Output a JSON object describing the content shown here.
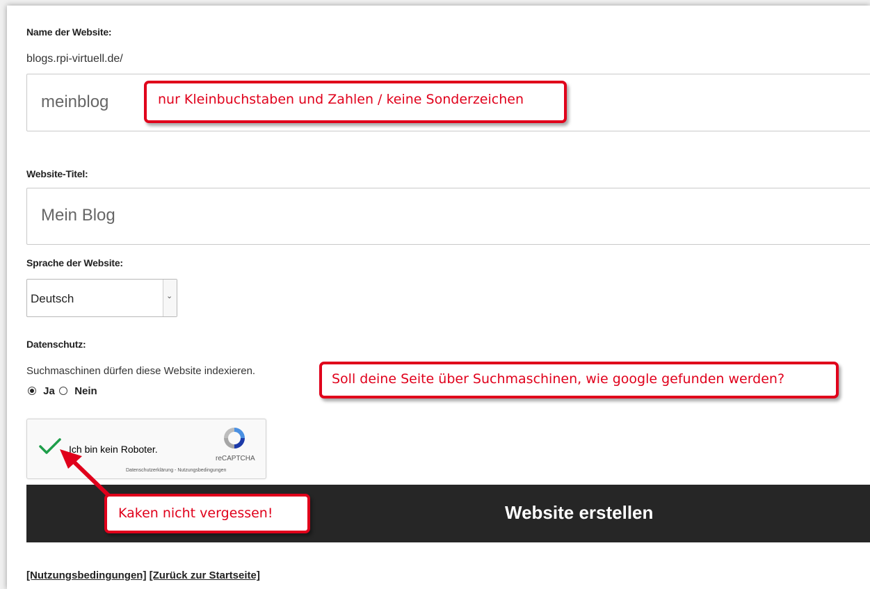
{
  "form": {
    "site_name_label": "Name der Website:",
    "domain_prefix": "blogs.rpi-virtuell.de/",
    "site_name_value": "meinblog",
    "site_title_label": "Website-Titel:",
    "site_title_value": "Mein Blog",
    "language_label": "Sprache der Website:",
    "language_value": "Deutsch",
    "privacy_label": "Datenschutz:",
    "privacy_text": "Suchmaschinen dürfen diese Website indexieren.",
    "privacy_yes": "Ja",
    "privacy_no": "Nein",
    "privacy_selected": "Ja",
    "submit_label": "Website erstellen"
  },
  "captcha": {
    "label": "Ich bin kein Roboter.",
    "brand": "reCAPTCHA",
    "privacy_link": "Datenschutzerklärung",
    "separator": " - ",
    "terms_link": "Nutzungsbedingungen",
    "checked": true
  },
  "footer": {
    "terms_link": "[Nutzungsbedingungen]",
    "home_link": "[Zurück zur Startseite]"
  },
  "annotations": {
    "site_name_note": "nur Kleinbuchstaben und Zahlen / keine Sonderzeichen",
    "privacy_note": "Soll deine Seite über Suchmaschinen, wie google gefunden werden?",
    "captcha_note": "Kaken nicht vergessen!"
  },
  "colors": {
    "annotation_red": "#e0001b",
    "submit_background": "#262626",
    "checkmark_green": "#1e9e4a"
  }
}
